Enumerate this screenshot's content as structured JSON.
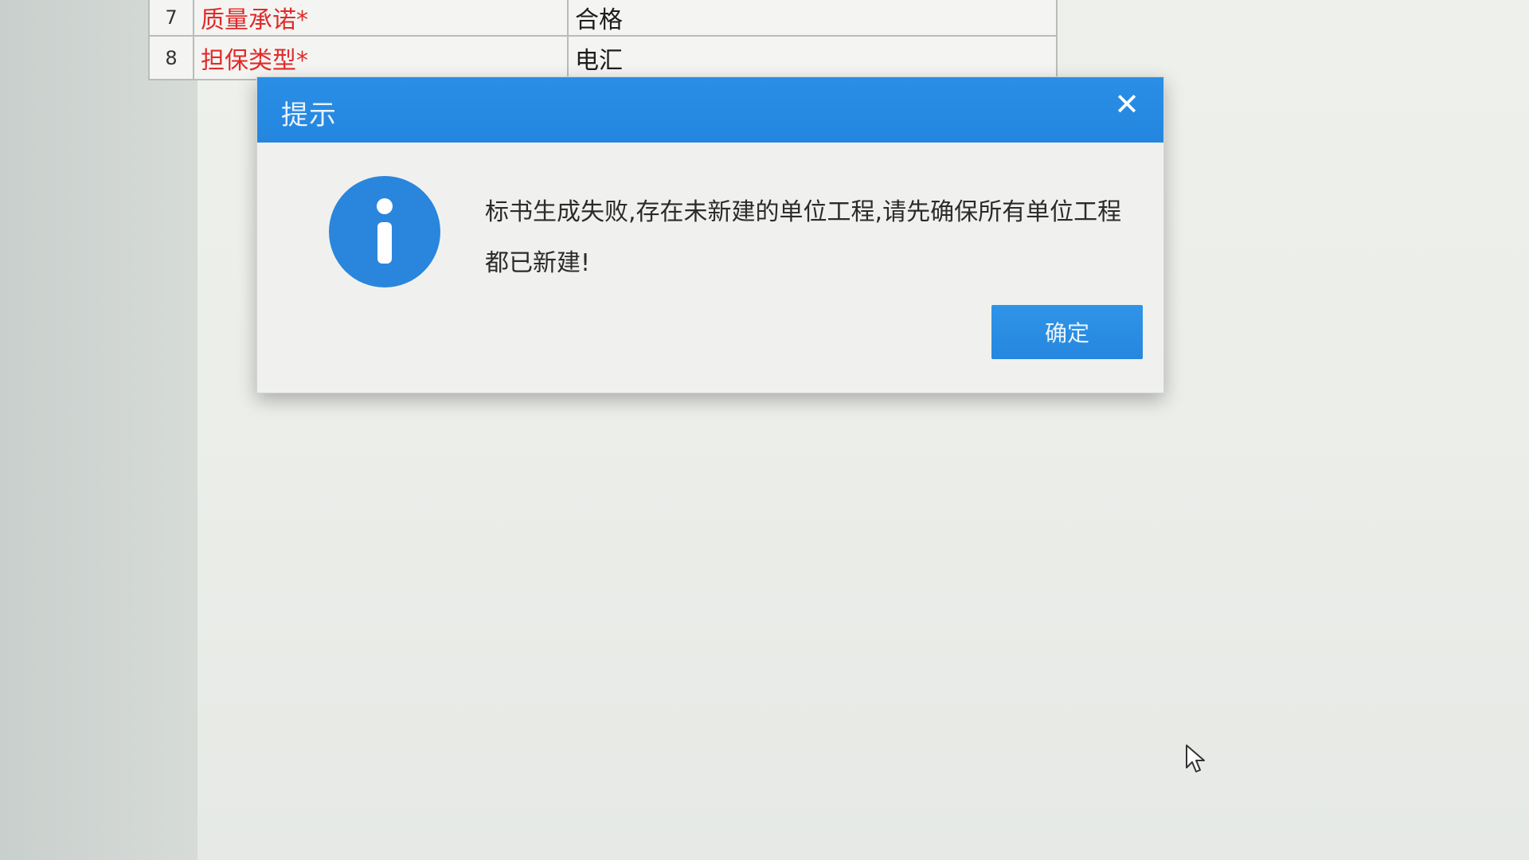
{
  "form": {
    "rows": [
      {
        "num": "7",
        "label": "质量承诺*",
        "value": "合格"
      },
      {
        "num": "8",
        "label": "担保类型*",
        "value": "电汇"
      }
    ]
  },
  "dialog": {
    "title": "提示",
    "close_symbol": "✕",
    "icon": "info-icon",
    "message": "标书生成失败,存在未新建的单位工程,请先确保所有单位工程都已新建!",
    "ok_label": "确定"
  },
  "colors": {
    "header_blue": "#2486df",
    "button_blue": "#2587dd",
    "icon_blue": "#2a86dc",
    "required_red": "#e02b2b"
  }
}
